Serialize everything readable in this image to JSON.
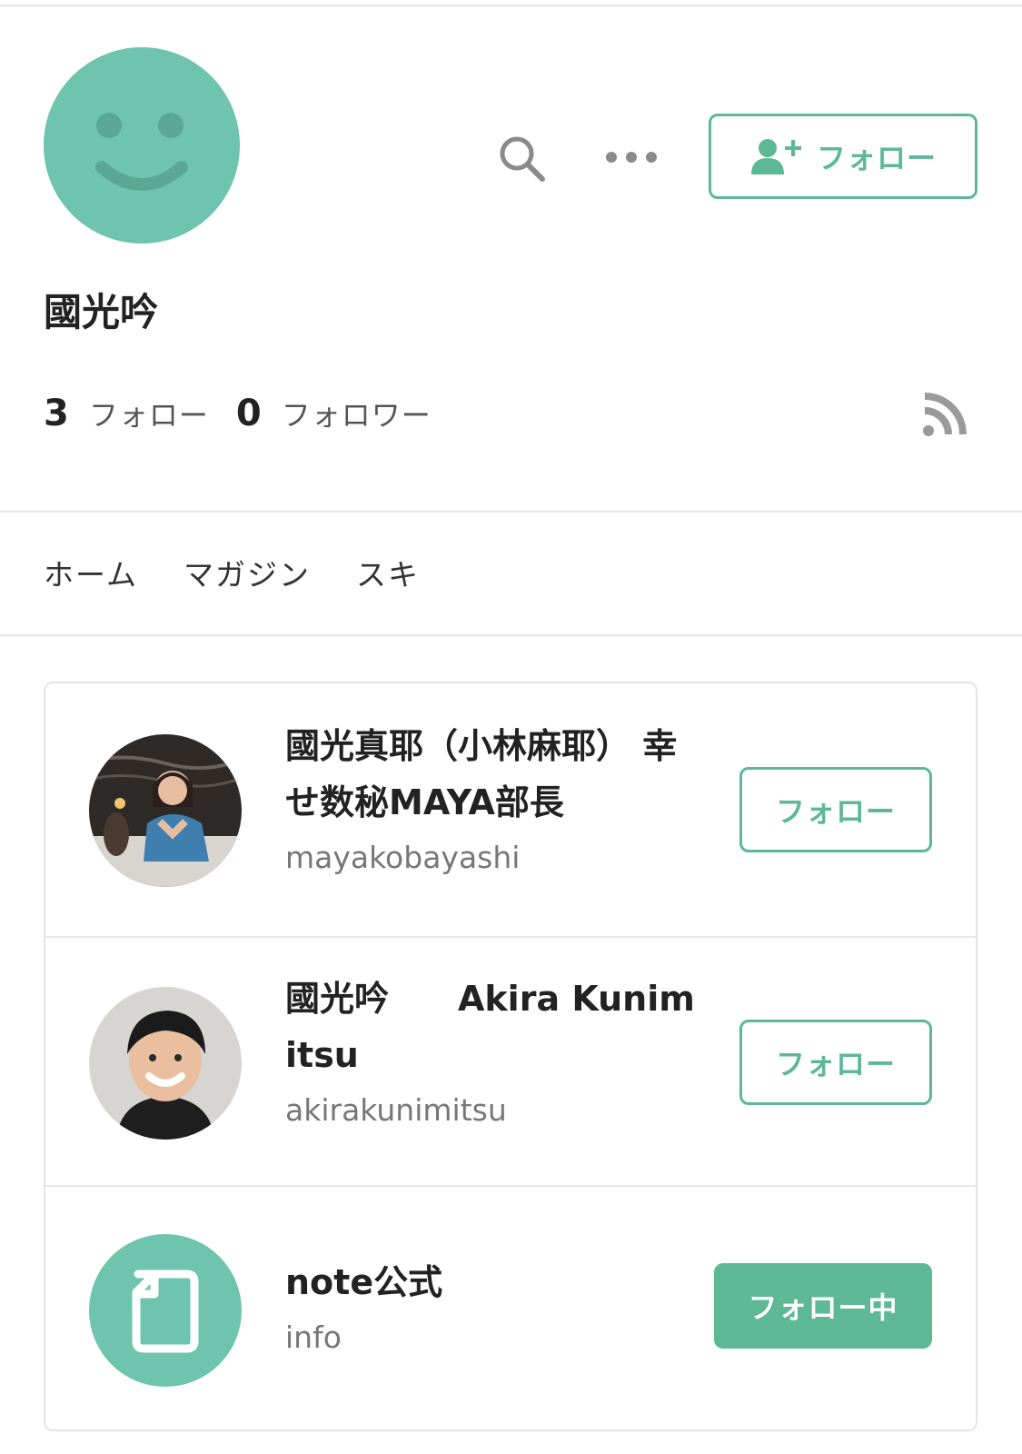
{
  "profile": {
    "name": "國光吟",
    "follow_button_label": "フォロー",
    "stats": {
      "following_count": "3",
      "following_label": "フォロー",
      "followers_count": "0",
      "followers_label": "フォロワー"
    }
  },
  "tabs": [
    {
      "label": "ホーム"
    },
    {
      "label": "マガジン"
    },
    {
      "label": "スキ"
    }
  ],
  "following_list": [
    {
      "name": "國光真耶（小林麻耶） 幸せ数秘MAYA部長",
      "username": "mayakobayashi",
      "button_label": "フォロー",
      "avatar": "photo-woman-avatar"
    },
    {
      "name": "國光吟　　Akira Kunimitsu",
      "username": "akirakunimitsu",
      "button_label": "フォロー",
      "avatar": "photo-man-avatar"
    },
    {
      "name": "note公式",
      "username": "info",
      "button_label": "フォロー中",
      "avatar": "note-logo-avatar"
    }
  ],
  "colors": {
    "accent": "#5db896",
    "avatar_bg": "#6ec4ad",
    "divider": "#e6e6e6"
  },
  "icons": [
    "smiley-face-icon",
    "search-icon",
    "more-options-icon",
    "add-user-icon",
    "rss-icon",
    "note-document-icon"
  ]
}
